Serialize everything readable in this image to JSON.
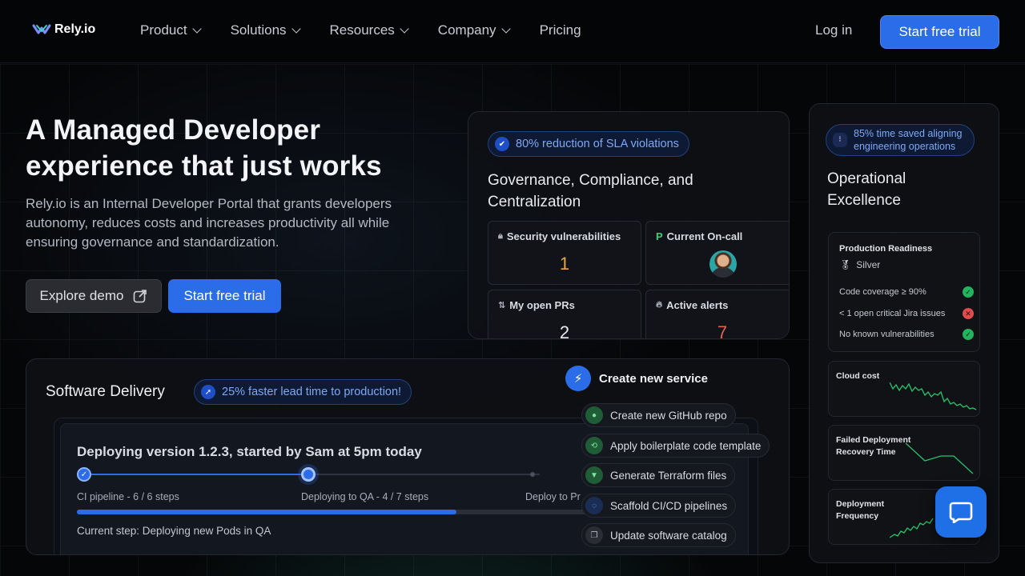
{
  "nav": {
    "logo_text": "Rely.io",
    "items": [
      {
        "label": "Product",
        "has_dropdown": true
      },
      {
        "label": "Solutions",
        "has_dropdown": true
      },
      {
        "label": "Resources",
        "has_dropdown": true
      },
      {
        "label": "Company",
        "has_dropdown": true
      },
      {
        "label": "Pricing",
        "has_dropdown": false
      }
    ],
    "login_label": "Log in",
    "cta_label": "Start free trial"
  },
  "hero": {
    "title_line1": "A Managed Developer",
    "title_line2": "experience that just works",
    "subtitle": "Rely.io is an Internal Developer Portal that grants developers autonomy, reduces costs and increases productivity all while ensuring governance and standardization.",
    "demo_label": "Explore demo",
    "trial_label": "Start free trial"
  },
  "governance": {
    "pill": "80% reduction of SLA violations",
    "title": "Governance, Compliance, and Centralization",
    "tiles": [
      {
        "label": "Security vulnerabilities",
        "value": "1",
        "color": "#e5a64a"
      },
      {
        "label": "Current On-call",
        "value": "",
        "color": "#3ccf7a"
      },
      {
        "label": "My open PRs",
        "value": "2",
        "color": "#e8eaef"
      },
      {
        "label": "Active alerts",
        "value": "7",
        "color": "#e4614f"
      }
    ]
  },
  "operations": {
    "pill_line1": "85% time saved aligning",
    "pill_line2": "engineering operations",
    "title_line1": "Operational",
    "title_line2": "Excellence",
    "readiness": {
      "title": "Production Readiness",
      "level": "Silver",
      "checks": [
        {
          "label": "Code coverage ≥ 90%",
          "passed": true
        },
        {
          "label": "< 1 open critical Jira issues",
          "passed": false
        },
        {
          "label": "No known vulnerabilities",
          "passed": true
        }
      ]
    },
    "cloud_cost": "Cloud cost",
    "failed_line1": "Failed Deployment",
    "failed_line2": "Recovery Time",
    "freq_line1": "Deployment",
    "freq_line2": "Frequency"
  },
  "delivery": {
    "title": "Software Delivery",
    "pill": "25% faster lead time to production!",
    "deploy_title": "Deploying version 1.2.3, started by Sam at 5pm today",
    "steps": [
      "CI pipeline - 6 / 6 steps",
      "Deploying to QA - 4 / 7 steps",
      "Deploy to Pr"
    ],
    "progress": 0.74,
    "current_step": "Current step: Deploying new Pods in QA"
  },
  "create_service": {
    "title": "Create new service",
    "steps": [
      "Create new GitHub repo",
      "Apply boilerplate code template",
      "Generate Terraform files",
      "Scaffold CI/CD pipelines",
      "Update software catalog"
    ]
  },
  "colors": {
    "accent": "#2b6de9",
    "success": "#22b35e",
    "danger": "#e14b4b"
  }
}
